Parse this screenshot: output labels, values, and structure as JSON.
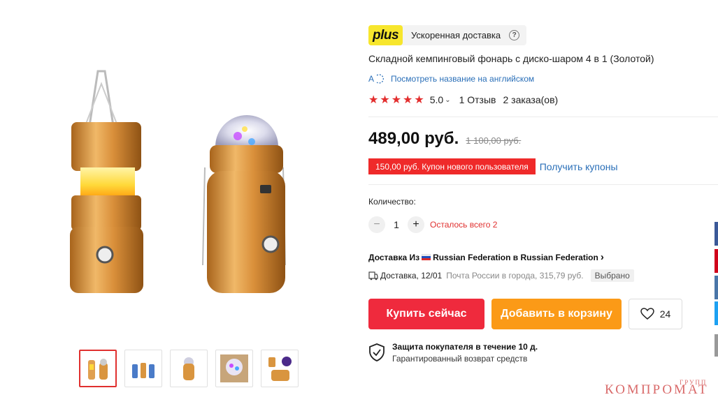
{
  "plus": {
    "badge": "plus",
    "label": "Ускоренная доставка",
    "help": "?"
  },
  "product": {
    "title": "Складной кемпинговый фонарь с диско-шаром 4 в 1 (Золотой)",
    "translate_link": "Посмотреть название на английском",
    "rating": "5.0",
    "rating_chevron": "⌄",
    "reviews": "1 Отзыв",
    "orders": "2 заказа(ов)",
    "stars": [
      "★",
      "★",
      "★",
      "★",
      "★"
    ]
  },
  "price": {
    "current": "489,00 руб.",
    "old": "1 100,00 руб."
  },
  "coupon": {
    "badge": "150,00 руб. Купон нового пользователя",
    "link": "Получить купоны"
  },
  "quantity": {
    "label": "Количество:",
    "minus": "−",
    "value": "1",
    "plus": "+",
    "stock": "Осталось всего 2"
  },
  "delivery": {
    "prefix": "Доставка Из",
    "route": "Russian Federation в Russian Federation",
    "chevron": "›",
    "date": "Доставка, 12/01",
    "method": "Почта России в города, 315,79 руб.",
    "selected": "Выбрано"
  },
  "buttons": {
    "buy": "Купить сейчас",
    "cart": "Добавить в корзину",
    "wishlist_count": "24"
  },
  "protection": {
    "title": "Защита покупателя в течение 10 д.",
    "subtitle": "Гарантированный возврат средств"
  },
  "watermark": {
    "main": "КОМПРОМАТ",
    "small": "ГРУПП"
  },
  "colors": {
    "accent_red": "#ef2a3d",
    "accent_orange": "#fb9a17",
    "link_blue": "#2a6fb8",
    "plus_yellow": "#f7e62d"
  },
  "icons": [
    "help-icon",
    "translate-icon",
    "star-icon",
    "truck-icon",
    "heart-icon",
    "shield-check-icon",
    "russia-flag-icon"
  ]
}
